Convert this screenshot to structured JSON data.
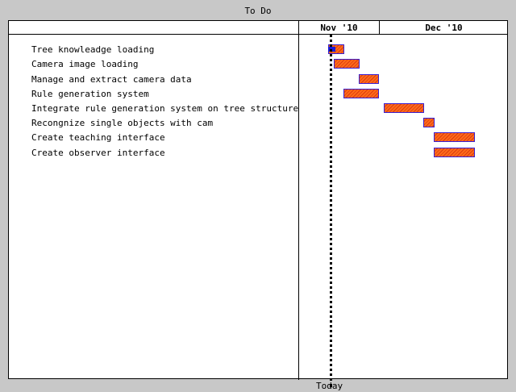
{
  "window": {
    "title": "To Do"
  },
  "timeline": {
    "months": [
      "Nov '10",
      "Dec '10"
    ],
    "today_label": "Today"
  },
  "tasks": [
    {
      "name": "Tree knowleadge loading"
    },
    {
      "name": "Camera image loading"
    },
    {
      "name": "Manage and extract camera data"
    },
    {
      "name": "Rule generation system"
    },
    {
      "name": "Integrate rule generation system on tree structure"
    },
    {
      "name": "Recongnize single objects with cam"
    },
    {
      "name": "Create teaching interface"
    },
    {
      "name": "Create observer interface"
    }
  ],
  "colors": {
    "background": "#c8c8c8",
    "chart_background": "#ffffff",
    "bar_fill": "#ff6a1a",
    "bar_hatch": "#d83a10",
    "bar_border": "#3a1fd0",
    "progress": "#1a1ad8"
  }
}
